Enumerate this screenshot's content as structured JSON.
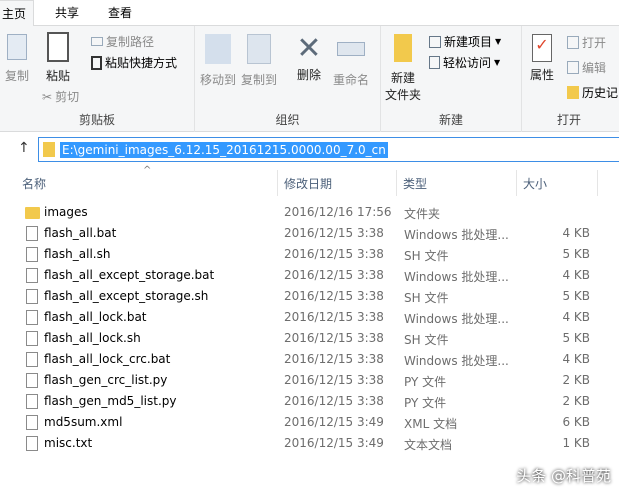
{
  "tabs": [
    "主页",
    "共享",
    "查看"
  ],
  "ribbon": {
    "clipboard": {
      "label": "剪贴板",
      "copy": "复制",
      "paste": "粘贴",
      "copy_path": "复制路径",
      "paste_shortcut": "粘贴快捷方式",
      "cut": "剪切"
    },
    "organize": {
      "label": "组织",
      "move_to": "移动到",
      "copy_to": "复制到",
      "delete": "删除",
      "rename": "重命名"
    },
    "new": {
      "label": "新建",
      "new_folder_1": "新建",
      "new_folder_2": "文件夹",
      "new_item": "新建项目",
      "easy_access": "轻松访问"
    },
    "open": {
      "label": "打开",
      "properties": "属性",
      "open": "打开",
      "edit": "编辑",
      "history": "历史记"
    }
  },
  "address": {
    "path": "E:\\gemini_images_6.12.15_20161215.0000.00_7.0_cn"
  },
  "columns": [
    "名称",
    "修改日期",
    "类型",
    "大小"
  ],
  "files": [
    {
      "name": "images",
      "date": "2016/12/16 17:56",
      "type": "文件夹",
      "size": "",
      "kind": "folder"
    },
    {
      "name": "flash_all.bat",
      "date": "2016/12/15 3:38",
      "type": "Windows 批处理...",
      "size": "4 KB",
      "kind": "bat"
    },
    {
      "name": "flash_all.sh",
      "date": "2016/12/15 3:38",
      "type": "SH 文件",
      "size": "5 KB",
      "kind": "file"
    },
    {
      "name": "flash_all_except_storage.bat",
      "date": "2016/12/15 3:38",
      "type": "Windows 批处理...",
      "size": "4 KB",
      "kind": "bat"
    },
    {
      "name": "flash_all_except_storage.sh",
      "date": "2016/12/15 3:38",
      "type": "SH 文件",
      "size": "5 KB",
      "kind": "file"
    },
    {
      "name": "flash_all_lock.bat",
      "date": "2016/12/15 3:38",
      "type": "Windows 批处理...",
      "size": "4 KB",
      "kind": "bat"
    },
    {
      "name": "flash_all_lock.sh",
      "date": "2016/12/15 3:38",
      "type": "SH 文件",
      "size": "5 KB",
      "kind": "file"
    },
    {
      "name": "flash_all_lock_crc.bat",
      "date": "2016/12/15 3:38",
      "type": "Windows 批处理...",
      "size": "4 KB",
      "kind": "bat"
    },
    {
      "name": "flash_gen_crc_list.py",
      "date": "2016/12/15 3:38",
      "type": "PY 文件",
      "size": "2 KB",
      "kind": "file"
    },
    {
      "name": "flash_gen_md5_list.py",
      "date": "2016/12/15 3:38",
      "type": "PY 文件",
      "size": "2 KB",
      "kind": "file"
    },
    {
      "name": "md5sum.xml",
      "date": "2016/12/15 3:49",
      "type": "XML 文档",
      "size": "6 KB",
      "kind": "xml"
    },
    {
      "name": "misc.txt",
      "date": "2016/12/15 3:49",
      "type": "文本文档",
      "size": "1 KB",
      "kind": "file"
    }
  ],
  "watermark": "头条 @科普苑"
}
